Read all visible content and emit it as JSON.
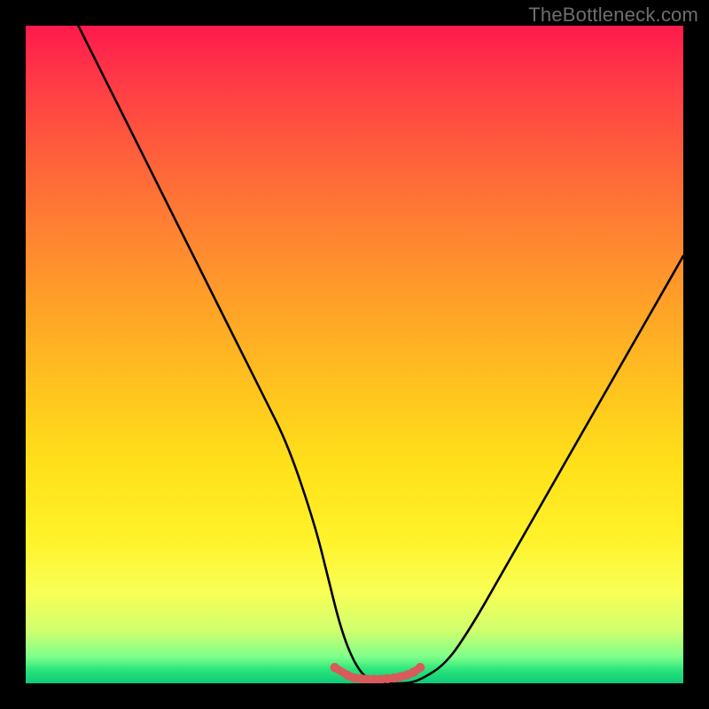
{
  "watermark": "TheBottleneck.com",
  "chart_data": {
    "type": "line",
    "title": "",
    "xlabel": "",
    "ylabel": "",
    "xlim": [
      0,
      100
    ],
    "ylim": [
      0,
      100
    ],
    "grid": false,
    "series": [
      {
        "name": "curve",
        "color": "#000000",
        "x": [
          8,
          12,
          16,
          20,
          24,
          28,
          32,
          36,
          40,
          44,
          46,
          48,
          50,
          52,
          54,
          56,
          58,
          60,
          64,
          68,
          72,
          76,
          80,
          84,
          88,
          92,
          96,
          100
        ],
        "y": [
          100,
          92,
          84,
          76,
          68,
          60,
          52,
          44,
          36,
          24,
          16,
          8,
          3,
          0.5,
          0,
          0,
          0,
          0.5,
          3,
          9,
          16,
          23,
          30,
          37,
          44,
          51,
          58,
          65
        ]
      },
      {
        "name": "bottom-cluster",
        "color": "#d95a5a",
        "type": "scatter",
        "x": [
          47,
          49,
          50,
          51,
          52,
          53,
          54,
          55,
          56,
          57,
          58,
          59,
          60
        ],
        "y": [
          2.4,
          1.2,
          0.8,
          0.7,
          0.6,
          0.6,
          0.6,
          0.7,
          0.8,
          1.0,
          1.3,
          1.7,
          2.4
        ]
      }
    ],
    "background_gradient": {
      "top": "#ff1a4d",
      "mid_upper": "#ffa028",
      "mid_lower": "#fff22a",
      "bottom": "#10c97a"
    }
  }
}
